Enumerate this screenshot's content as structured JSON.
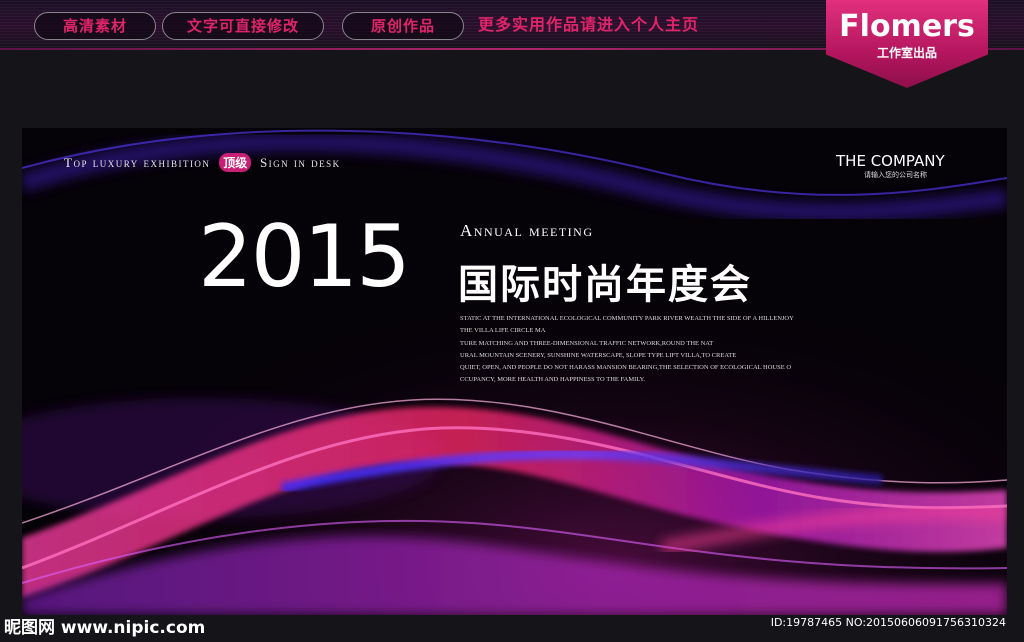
{
  "topbar": {
    "tags": [
      "高清素材",
      "文字可直接修改",
      "原创作品"
    ],
    "link": "更多实用作品请进入个人主页",
    "brand_name": "Flomers",
    "brand_sub": "工作室出品"
  },
  "banner": {
    "tagline_left": "Top luxury exhibition",
    "tagline_badge": "顶级",
    "tagline_right": "Sign in desk",
    "company": "THE COMPANY",
    "company_sub": "请输入您的公司名称",
    "year": "2015",
    "annual": "Annual meeting",
    "title_cn": "国际时尚年度会",
    "paragraph_lines": [
      "STATIC AT THE INTERNATIONAL ECOLOGICAL COMMUNITY PARK RIVER WEALTH THE SIDE OF A HILLENJOY",
      "THE VILLA LIFE CIRCLE MA",
      "TURE MATCHING AND THREE-DIMENSIONAL TRAFFIC NETWORK,ROUND THE NAT",
      "URAL MOUNTAIN SCENERY, SUNSHINE WATERSCAPE, SLOPE TYPE LIFT VILLA,TO CREATE",
      "QUIET, OPEN, AND PEOPLE DO NOT HARASS MANSION BEARING,THE SELECTION OF ECOLOGICAL HOUSE O",
      "CCUPANCY, MORE HEALTH AND HAPPINESS TO THE FAMILY."
    ]
  },
  "footer": {
    "site": "昵图网 www.nipic.com",
    "id": "ID:19787465 NO:20150606091756310324"
  },
  "colors": {
    "accent": "#e0246a",
    "magenta": "#c71f73",
    "violet": "#5a2be0"
  }
}
